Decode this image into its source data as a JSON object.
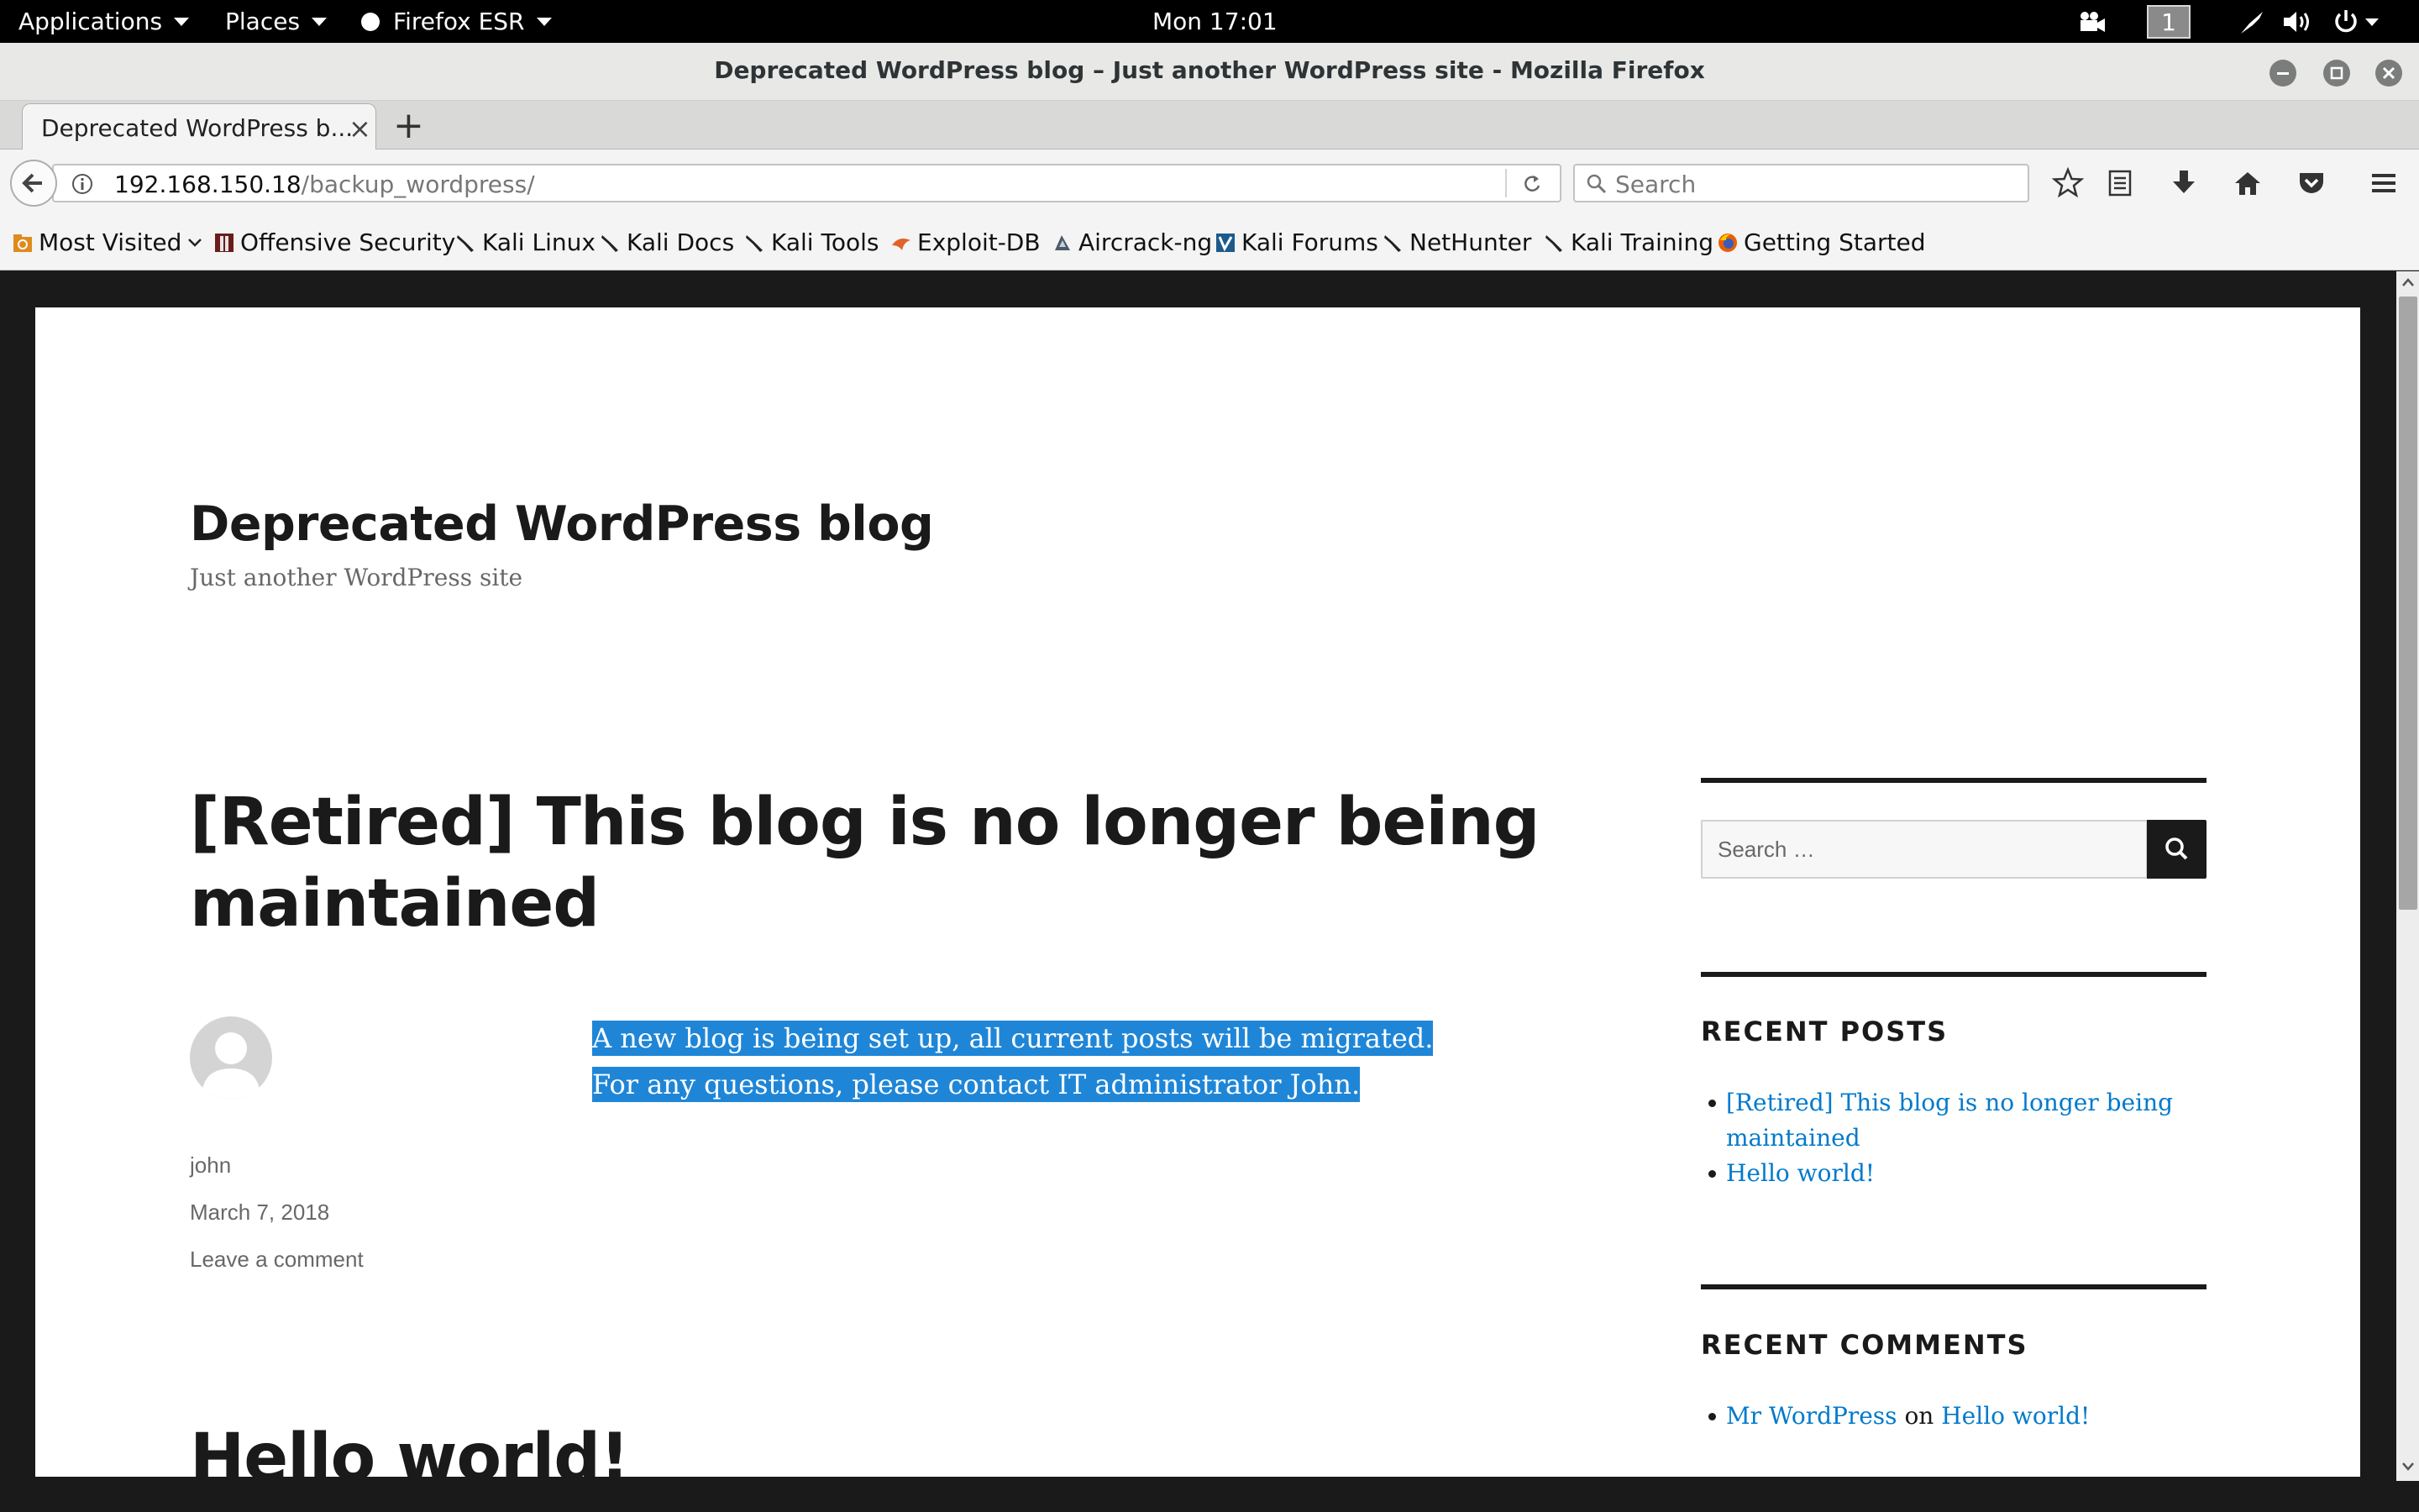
{
  "topbar": {
    "applications": "Applications",
    "places": "Places",
    "firefox": "Firefox ESR",
    "clock": "Mon 17:01",
    "workspace": "1"
  },
  "window": {
    "title": "Deprecated WordPress blog – Just another WordPress site - Mozilla Firefox"
  },
  "tab": {
    "title": "Deprecated WordPress b...",
    "close": "×",
    "new_tab": "+"
  },
  "navbar": {
    "url_host": "192.168.150.18",
    "url_path": "/backup_wordpress/",
    "search_placeholder": "Search"
  },
  "bookmarks": [
    {
      "label": "Most Visited",
      "icon": "most-visited-icon"
    },
    {
      "label": "Offensive Security",
      "icon": "offsec-icon"
    },
    {
      "label": "Kali Linux",
      "icon": "kali-icon"
    },
    {
      "label": "Kali Docs",
      "icon": "kali-icon"
    },
    {
      "label": "Kali Tools",
      "icon": "kali-icon"
    },
    {
      "label": "Exploit-DB",
      "icon": "exploitdb-icon"
    },
    {
      "label": "Aircrack-ng",
      "icon": "aircrack-icon"
    },
    {
      "label": "Kali Forums",
      "icon": "kali-forums-icon"
    },
    {
      "label": "NetHunter",
      "icon": "kali-icon"
    },
    {
      "label": "Kali Training",
      "icon": "kali-icon"
    },
    {
      "label": "Getting Started",
      "icon": "firefox-icon"
    }
  ],
  "site": {
    "title": "Deprecated WordPress blog",
    "description": "Just another WordPress site"
  },
  "post": {
    "title": "[Retired] This blog is no longer being maintained",
    "author": "john",
    "date": "March 7, 2018",
    "comment_link": "Leave a comment",
    "body_line1": "A new blog is being set up, all current posts will be migrated.",
    "body_line2": "For any questions, please contact IT administrator John."
  },
  "second_post": {
    "title": "Hello world!"
  },
  "sidebar": {
    "search_placeholder": "Search …",
    "recent_posts_heading": "RECENT POSTS",
    "recent_posts": [
      "[Retired] This blog is no longer being maintained",
      "Hello world!"
    ],
    "recent_comments_heading": "RECENT COMMENTS",
    "recent_comment": {
      "author": "Mr WordPress",
      "on": "on",
      "post": "Hello world!"
    }
  },
  "colors": {
    "link": "#007acc",
    "selection": "#1f86d7",
    "text": "#1a1a1a"
  }
}
